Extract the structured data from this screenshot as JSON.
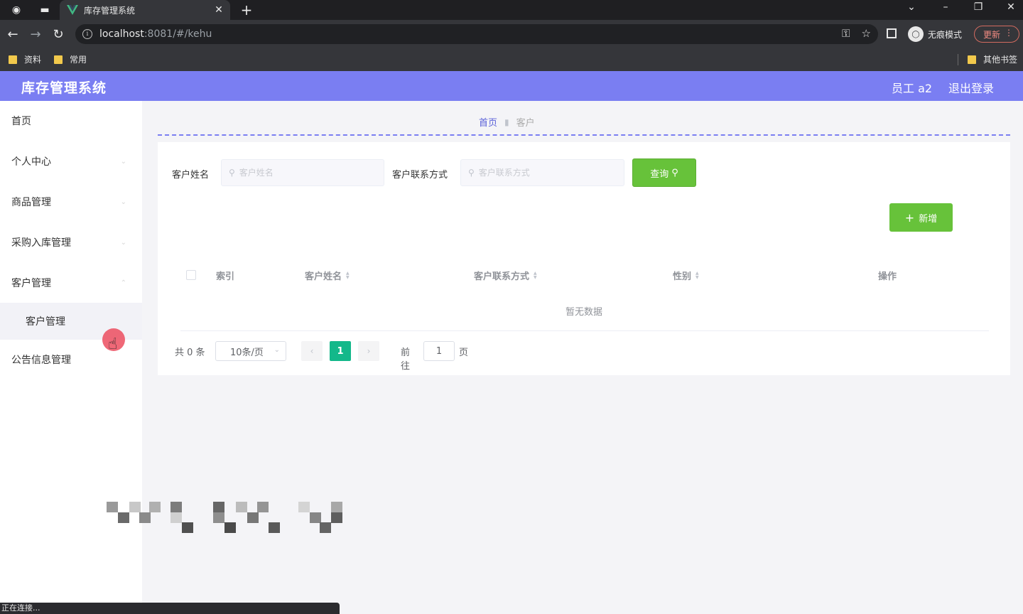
{
  "browser": {
    "tab_title": "库存管理系统",
    "url_host": "localhost",
    "url_rest": ":8081/#/kehu",
    "incognito_label": "无痕模式",
    "update_label": "更新",
    "bookmarks": [
      "资料",
      "常用"
    ],
    "other_bookmarks": "其他书签",
    "status_text": "正在连接..."
  },
  "header": {
    "title": "库存管理系统",
    "user": "员工 a2",
    "logout": "退出登录"
  },
  "sidebar": {
    "items": [
      {
        "label": "首页"
      },
      {
        "label": "个人中心"
      },
      {
        "label": "商品管理"
      },
      {
        "label": "采购入库管理"
      },
      {
        "label": "客户管理"
      }
    ],
    "sub_item": "客户管理",
    "last_item": "公告信息管理"
  },
  "breadcrumb": {
    "home": "首页",
    "current": "客户"
  },
  "search": {
    "name_label": "客户姓名",
    "name_placeholder": "客户姓名",
    "contact_label": "客户联系方式",
    "contact_placeholder": "客户联系方式",
    "query_button": "查询"
  },
  "actions": {
    "add_button": "新增"
  },
  "table": {
    "columns": [
      "索引",
      "客户姓名",
      "客户联系方式",
      "性别",
      "操作"
    ],
    "rows": [],
    "empty_text": "暂无数据"
  },
  "pagination": {
    "total": "共 0 条",
    "page_size": "10条/页",
    "current_page": "1",
    "goto_label": "前往",
    "goto_value": "1",
    "page_unit": "页"
  },
  "colors": {
    "header_bg": "#7a7ef2",
    "accent_green": "#67c23a",
    "page_active": "#13b88a"
  }
}
